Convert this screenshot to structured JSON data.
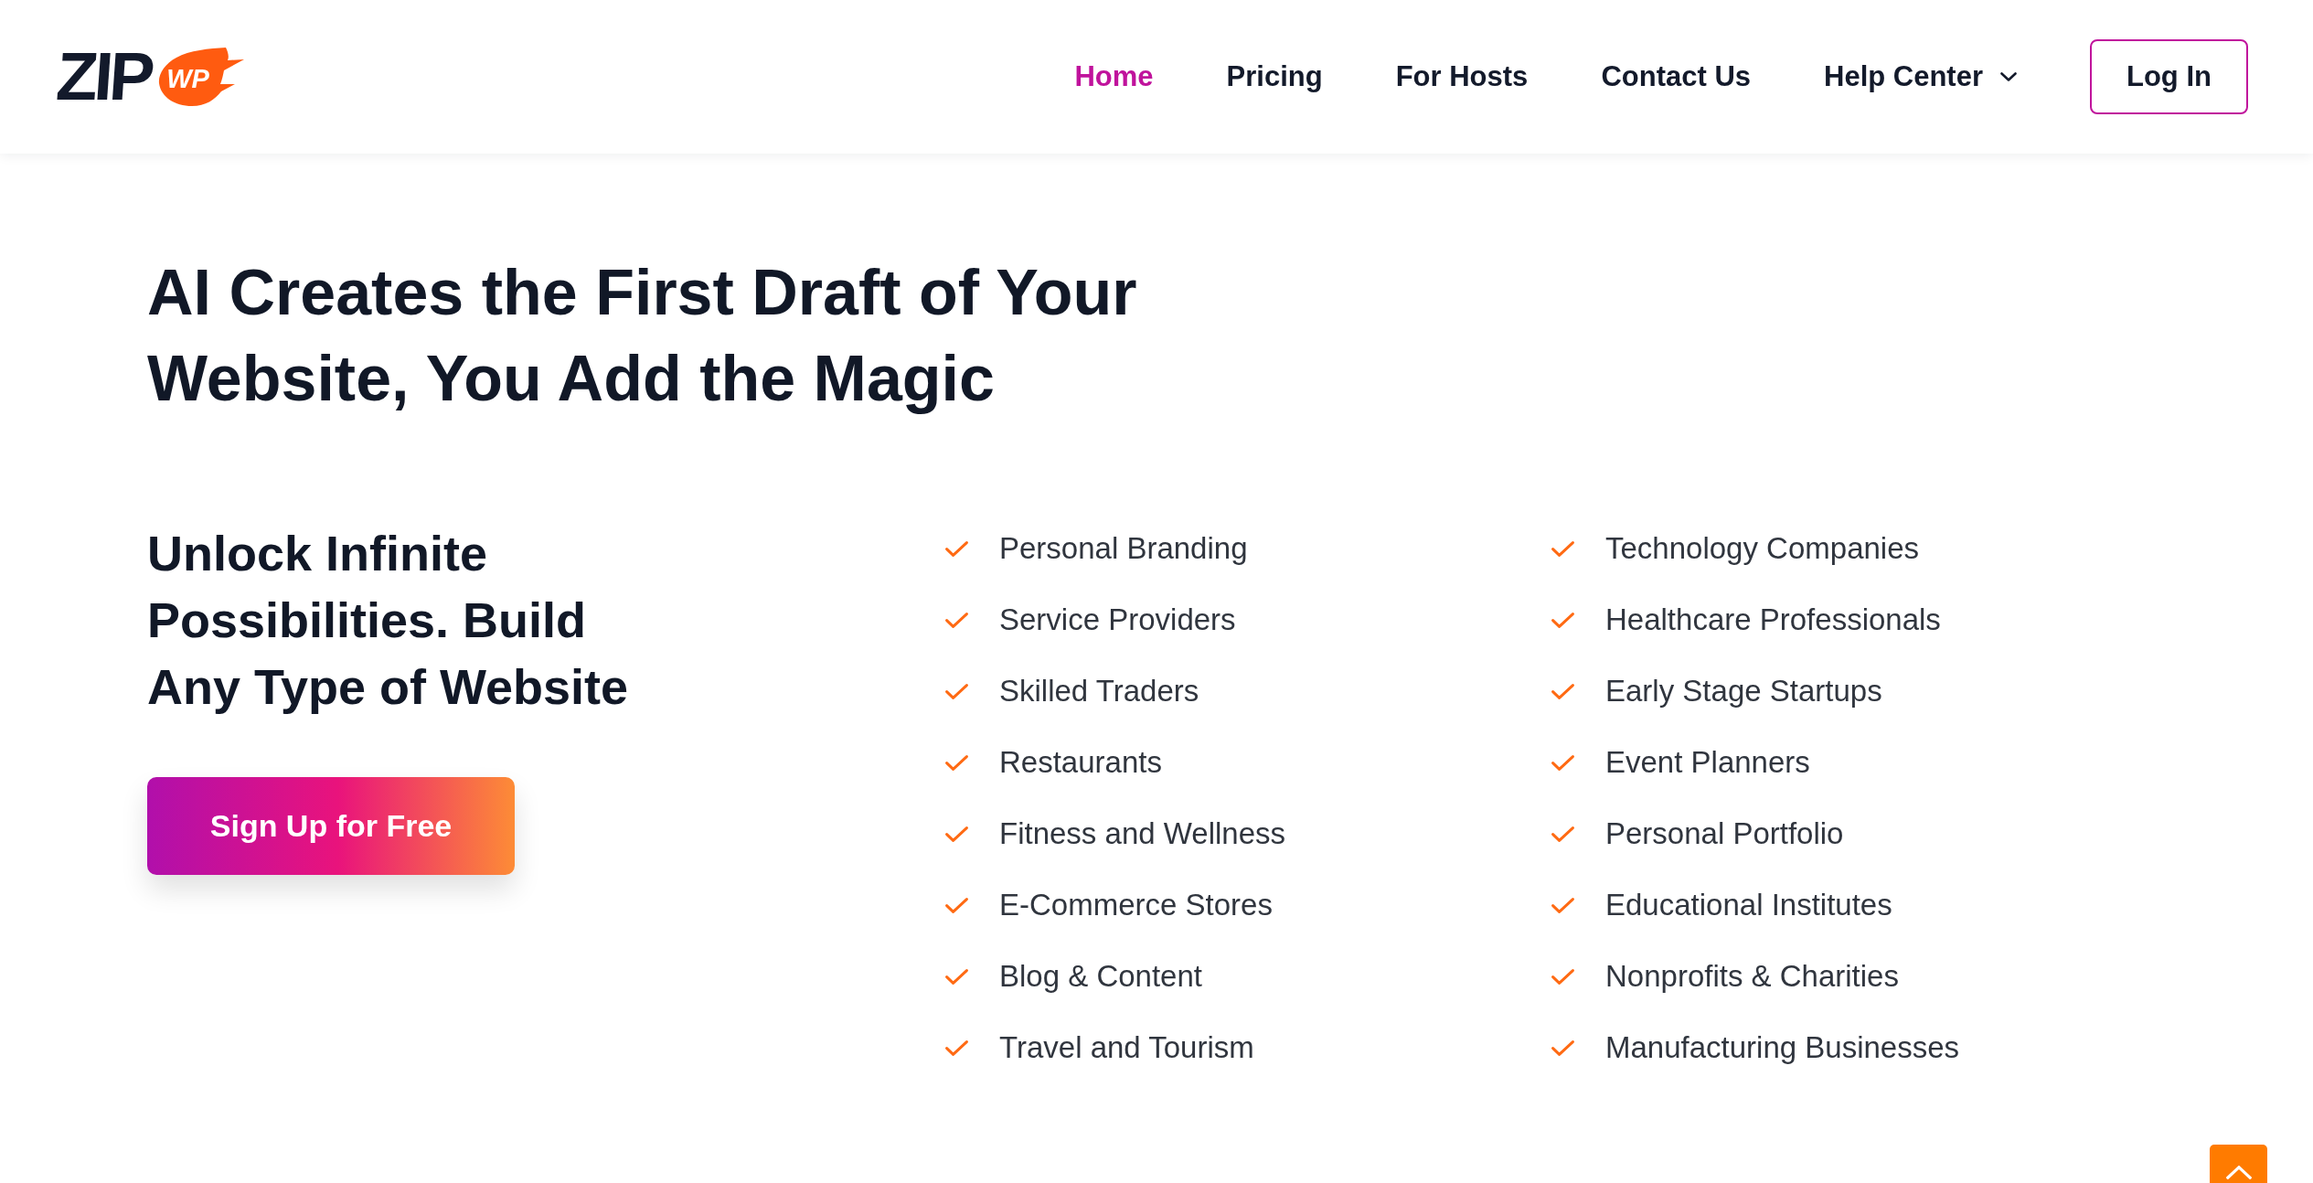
{
  "header": {
    "logo": {
      "wordmark": "ZIP",
      "badge": "WP"
    },
    "nav": [
      {
        "label": "Home",
        "kind": "link",
        "selected": true
      },
      {
        "label": "Pricing",
        "kind": "link",
        "selected": false
      },
      {
        "label": "For Hosts",
        "kind": "link",
        "selected": false
      },
      {
        "label": "Contact Us",
        "kind": "link",
        "selected": false
      },
      {
        "label": "Help Center",
        "kind": "dropdown",
        "selected": false
      }
    ],
    "login_button": "Log In"
  },
  "hero": {
    "title": "AI Creates the First Draft of Your Website, You Add the Magic",
    "subtitle": "Unlock Infinite Possibilities. Build Any Type of Website",
    "cta_button": "Sign Up for Free",
    "feature_columns": [
      {
        "items": [
          "Personal Branding",
          "Service Providers",
          "Skilled Traders",
          "Restaurants",
          "Fitness and Wellness",
          "E-Commerce Stores",
          "Blog & Content",
          "Travel and Tourism"
        ]
      },
      {
        "items": [
          "Technology Companies",
          "Healthcare Professionals",
          "Early Stage Startups",
          "Event Planners",
          "Personal Portfolio",
          "Educational Institutes",
          "Nonprofits & Charities",
          "Manufacturing Businesses"
        ]
      }
    ]
  }
}
